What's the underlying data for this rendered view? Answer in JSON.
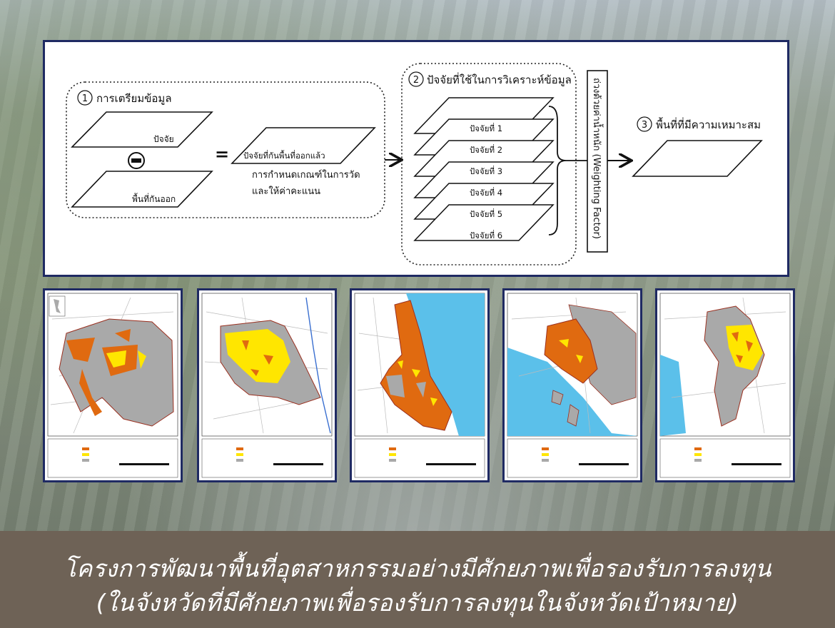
{
  "diagram": {
    "step1": {
      "number": "1",
      "label": "การเตรียมข้อมูล"
    },
    "layer_factor": "ปัจจัย",
    "layer_excluded": "พื้นที่กันออก",
    "minus_symbol": "−",
    "equals_symbol": "=",
    "result_layer": "ปัจจัยที่กันพื้นที่ออกแล้ว",
    "criteria_line1": "การกำหนดเกณฑ์ในการวัด",
    "criteria_line2": "และให้ค่าคะแนน",
    "step2": {
      "number": "2",
      "label": "ปัจจัยที่ใช้ในการวิเคราะห์ข้อมูล"
    },
    "factors": [
      "ปัจจัยที่ 1",
      "ปัจจัยที่ 2",
      "ปัจจัยที่ 3",
      "ปัจจัยที่ 4",
      "ปัจจัยที่ 5",
      "ปัจจัยที่ 6"
    ],
    "weighting_label": "ถ่วงด้วยค่าน้ำหนัก (Weighting Factor)",
    "step3": {
      "number": "3",
      "label": "พื้นที่ที่มีความเหมาะสม"
    }
  },
  "maps": [
    {
      "name": "map-1",
      "label": ""
    },
    {
      "name": "map-2",
      "label": ""
    },
    {
      "name": "map-3",
      "label": ""
    },
    {
      "name": "map-4",
      "label": ""
    },
    {
      "name": "map-5",
      "label": ""
    }
  ],
  "colors": {
    "navy_border": "#1f2a63",
    "orange_suitable": "#e06a10",
    "yellow_suitable": "#ffe600",
    "gray_area": "#a9a9a9",
    "sea_blue": "#5bc0ea",
    "title_band": "#6e6256"
  },
  "title": {
    "line1": "โครงการพัฒนาพื้นที่อุตสาหกรรมอย่างมีศักยภาพเพื่อรองรับการลงทุน",
    "line2": "(ในจังหวัดที่มีศักยภาพเพื่อรองรับการลงทุนในจังหวัดเป้าหมาย)"
  }
}
